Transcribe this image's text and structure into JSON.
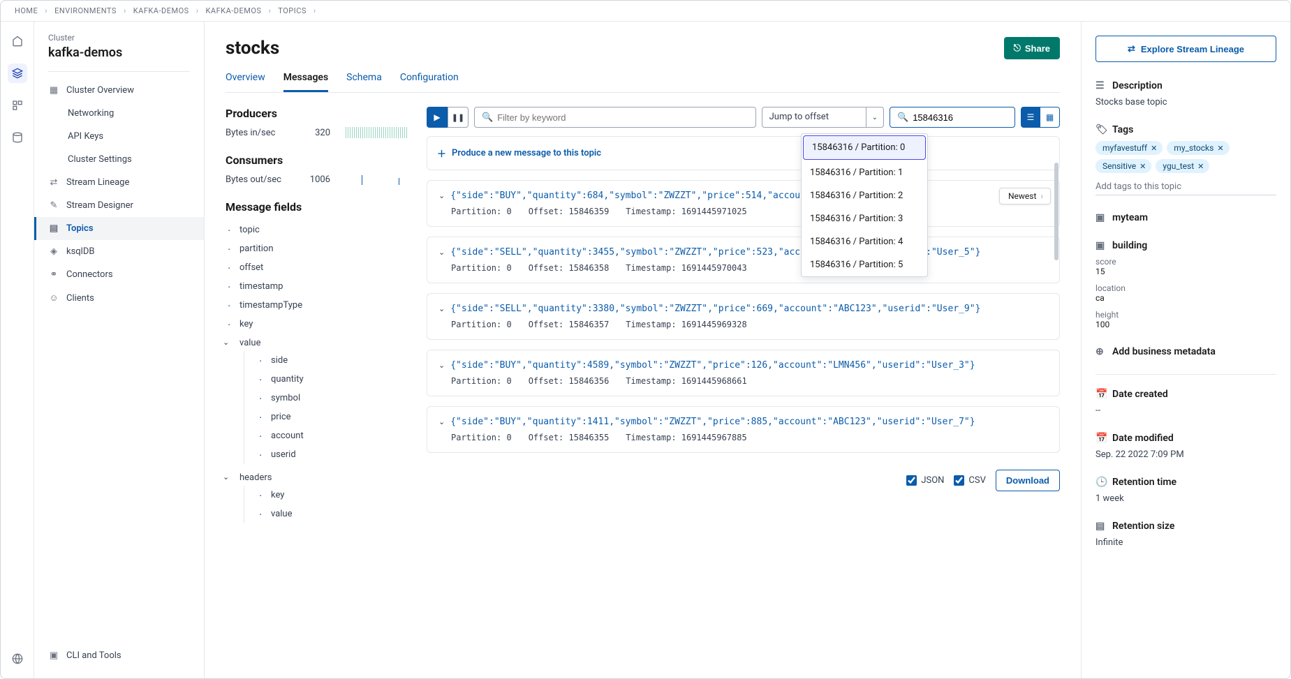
{
  "breadcrumb": [
    "HOME",
    "ENVIRONMENTS",
    "KAFKA-DEMOS",
    "KAFKA-DEMOS",
    "TOPICS"
  ],
  "cluster": {
    "label": "Cluster",
    "name": "kafka-demos"
  },
  "nav": {
    "overview": "Cluster Overview",
    "networking": "Networking",
    "apikeys": "API Keys",
    "settings": "Cluster Settings",
    "lineage": "Stream Lineage",
    "designer": "Stream Designer",
    "topics": "Topics",
    "ksql": "ksqlDB",
    "connectors": "Connectors",
    "clients": "Clients",
    "cli": "CLI and Tools"
  },
  "page": {
    "title": "stocks",
    "share": "Share"
  },
  "tabs": {
    "overview": "Overview",
    "messages": "Messages",
    "schema": "Schema",
    "config": "Configuration"
  },
  "producers": {
    "title": "Producers",
    "label": "Bytes in/sec",
    "value": "320"
  },
  "consumers": {
    "title": "Consumers",
    "label": "Bytes out/sec",
    "value": "1006"
  },
  "fields": {
    "title": "Message fields",
    "items": [
      "topic",
      "partition",
      "offset",
      "timestamp",
      "timestampType",
      "key"
    ],
    "value_label": "value",
    "value_items": [
      "side",
      "quantity",
      "symbol",
      "price",
      "account",
      "userid"
    ],
    "headers_label": "headers",
    "headers_items": [
      "key",
      "value"
    ]
  },
  "toolbar": {
    "filter_placeholder": "Filter by keyword",
    "jump": "Jump to offset",
    "offset_value": "15846316"
  },
  "dropdown": [
    "15846316 / Partition: 0",
    "15846316 / Partition: 1",
    "15846316 / Partition: 2",
    "15846316 / Partition: 3",
    "15846316 / Partition: 4",
    "15846316 / Partition: 5"
  ],
  "produce": "Produce a new message to this topic",
  "newest": "Newest",
  "messages": [
    {
      "json": "{\"side\":\"BUY\",\"quantity\":684,\"symbol\":\"ZWZZT\",\"price\":514,\"account                         r_4\"}",
      "partition": "Partition: 0",
      "offset": "Offset: 15846359",
      "ts": "Timestamp: 1691445971025"
    },
    {
      "json": "{\"side\":\"SELL\",\"quantity\":3455,\"symbol\":\"ZWZZT\",\"price\":523,\"account\":\"ABC123\",\"userid\":\"User_5\"}",
      "partition": "Partition: 0",
      "offset": "Offset: 15846358",
      "ts": "Timestamp: 1691445970043"
    },
    {
      "json": "{\"side\":\"SELL\",\"quantity\":3380,\"symbol\":\"ZWZZT\",\"price\":669,\"account\":\"ABC123\",\"userid\":\"User_9\"}",
      "partition": "Partition: 0",
      "offset": "Offset: 15846357",
      "ts": "Timestamp: 1691445969328"
    },
    {
      "json": "{\"side\":\"BUY\",\"quantity\":4589,\"symbol\":\"ZWZZT\",\"price\":126,\"account\":\"LMN456\",\"userid\":\"User_3\"}",
      "partition": "Partition: 0",
      "offset": "Offset: 15846356",
      "ts": "Timestamp: 1691445968661"
    },
    {
      "json": "{\"side\":\"BUY\",\"quantity\":1411,\"symbol\":\"ZWZZT\",\"price\":885,\"account\":\"ABC123\",\"userid\":\"User_7\"}",
      "partition": "Partition: 0",
      "offset": "Offset: 15846355",
      "ts": "Timestamp: 1691445967885"
    }
  ],
  "export": {
    "json": "JSON",
    "csv": "CSV",
    "download": "Download"
  },
  "right": {
    "lineage": "Explore Stream Lineage",
    "description_h": "Description",
    "description_v": "Stocks base topic",
    "tags_h": "Tags",
    "tags": [
      "myfavestuff",
      "my_stocks",
      "Sensitive",
      "ygu_test"
    ],
    "addtag": "Add tags to this topic",
    "myteam": "myteam",
    "building_h": "building",
    "building": {
      "score_k": "score",
      "score_v": "15",
      "loc_k": "location",
      "loc_v": "ca",
      "height_k": "height",
      "height_v": "100"
    },
    "addmeta": "Add business metadata",
    "created_h": "Date created",
    "created_v": "--",
    "modified_h": "Date modified",
    "modified_v": "Sep. 22 2022 7:09 PM",
    "retention_h": "Retention time",
    "retention_v": "1 week",
    "size_h": "Retention size",
    "size_v": "Infinite"
  }
}
